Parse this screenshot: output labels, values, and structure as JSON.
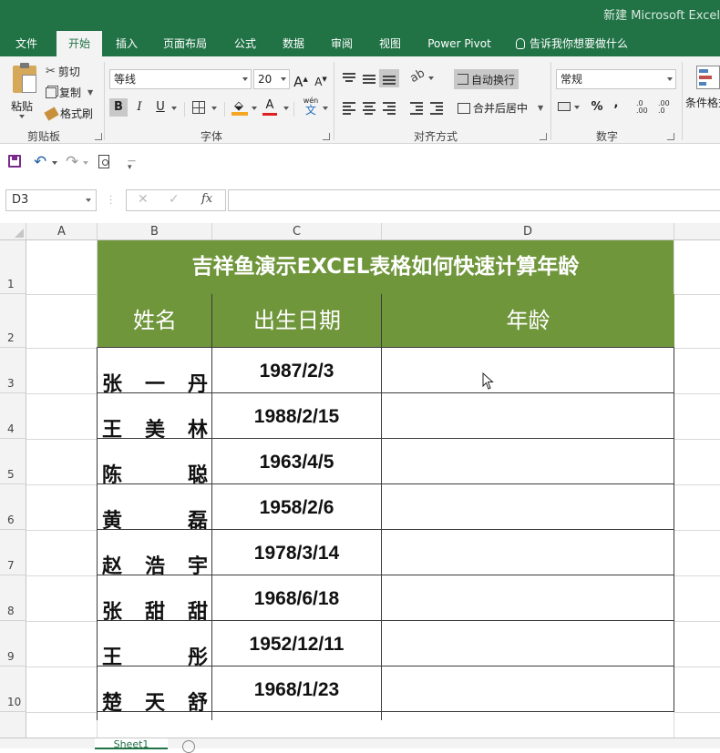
{
  "window": {
    "title": "新建 Microsoft Excel"
  },
  "tabs": [
    "文件",
    "开始",
    "插入",
    "页面布局",
    "公式",
    "数据",
    "审阅",
    "视图",
    "Power Pivot"
  ],
  "tell_me": "告诉我你想要做什么",
  "ribbon": {
    "clipboard": {
      "paste": "粘贴",
      "cut": "剪切",
      "copy": "复制",
      "format_painter": "格式刷",
      "label": "剪贴板"
    },
    "font": {
      "name": "等线",
      "size": "20",
      "grow": "A",
      "shrink": "A",
      "bold": "B",
      "italic": "I",
      "underline": "U",
      "color_a": "A",
      "wen": "wén",
      "label": "字体"
    },
    "alignment": {
      "wrap": "自动换行",
      "merge": "合并后居中",
      "label": "对齐方式"
    },
    "number": {
      "format": "常规",
      "percent": "%",
      "comma": ",",
      "label": "数字"
    },
    "styles": {
      "conditional": "条件格式"
    }
  },
  "formula_bar": {
    "name_box": "D3",
    "fx": "fx",
    "value": ""
  },
  "columns": [
    "A",
    "B",
    "C",
    "D"
  ],
  "rows": [
    "1",
    "2",
    "3",
    "4",
    "5",
    "6",
    "7",
    "8",
    "9",
    "10"
  ],
  "table": {
    "title": "吉祥鱼演示EXCEL表格如何快速计算年龄",
    "headers": [
      "姓名",
      "出生日期",
      "年龄"
    ],
    "records": [
      {
        "name": "张一丹",
        "date": "1987/2/3"
      },
      {
        "name": "王美林",
        "date": "1988/2/15"
      },
      {
        "name": "陈聪",
        "date": "1963/4/5"
      },
      {
        "name": "黄磊",
        "date": "1958/2/6"
      },
      {
        "name": "赵浩宇",
        "date": "1978/3/14"
      },
      {
        "name": "张甜甜",
        "date": "1968/6/18"
      },
      {
        "name": "王彤",
        "date": "1952/12/11"
      },
      {
        "name": "楚天舒",
        "date": "1968/1/23"
      }
    ]
  },
  "sheet_tabs": [
    "Sheet1"
  ],
  "colors": {
    "excel_green": "#217346",
    "header_fill": "#70963c"
  }
}
